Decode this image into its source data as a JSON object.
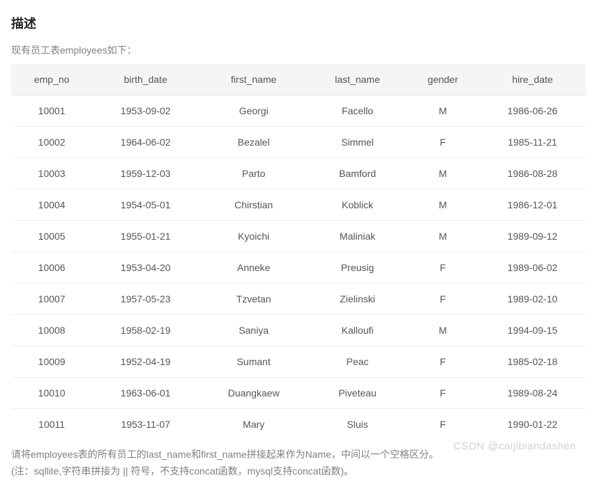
{
  "heading": "描述",
  "intro": "现有员工表employees如下：",
  "columns": [
    "emp_no",
    "birth_date",
    "first_name",
    "last_name",
    "gender",
    "hire_date"
  ],
  "rows": [
    [
      "10001",
      "1953-09-02",
      "Georgi",
      "Facello",
      "M",
      "1986-06-26"
    ],
    [
      "10002",
      "1964-06-02",
      "Bezalel",
      "Simmel",
      "F",
      "1985-11-21"
    ],
    [
      "10003",
      "1959-12-03",
      "Parto",
      "Bamford",
      "M",
      "1986-08-28"
    ],
    [
      "10004",
      "1954-05-01",
      "Chirstian",
      "Koblick",
      "M",
      "1986-12-01"
    ],
    [
      "10005",
      "1955-01-21",
      "Kyoichi",
      "Maliniak",
      "M",
      "1989-09-12"
    ],
    [
      "10006",
      "1953-04-20",
      "Anneke",
      "Preusig",
      "F",
      "1989-06-02"
    ],
    [
      "10007",
      "1957-05-23",
      "Tzvetan",
      "Zielinski",
      "F",
      "1989-02-10"
    ],
    [
      "10008",
      "1958-02-19",
      "Saniya",
      "Kalloufi",
      "M",
      "1994-09-15"
    ],
    [
      "10009",
      "1952-04-19",
      "Sumant",
      "Peac",
      "F",
      "1985-02-18"
    ],
    [
      "10010",
      "1963-06-01",
      "Duangkaew",
      "Piveteau",
      "F",
      "1989-08-24"
    ],
    [
      "10011",
      "1953-11-07",
      "Mary",
      "Sluis",
      "F",
      "1990-01-22"
    ]
  ],
  "description_line1": "请将employees表的所有员工的last_name和first_name拼接起来作为Name，中间以一个空格区分。",
  "description_line2": "(注：sqllite,字符串拼接为 || 符号，不支持concat函数，mysql支持concat函数)。",
  "watermark": "CSDN @caijibiandashen"
}
